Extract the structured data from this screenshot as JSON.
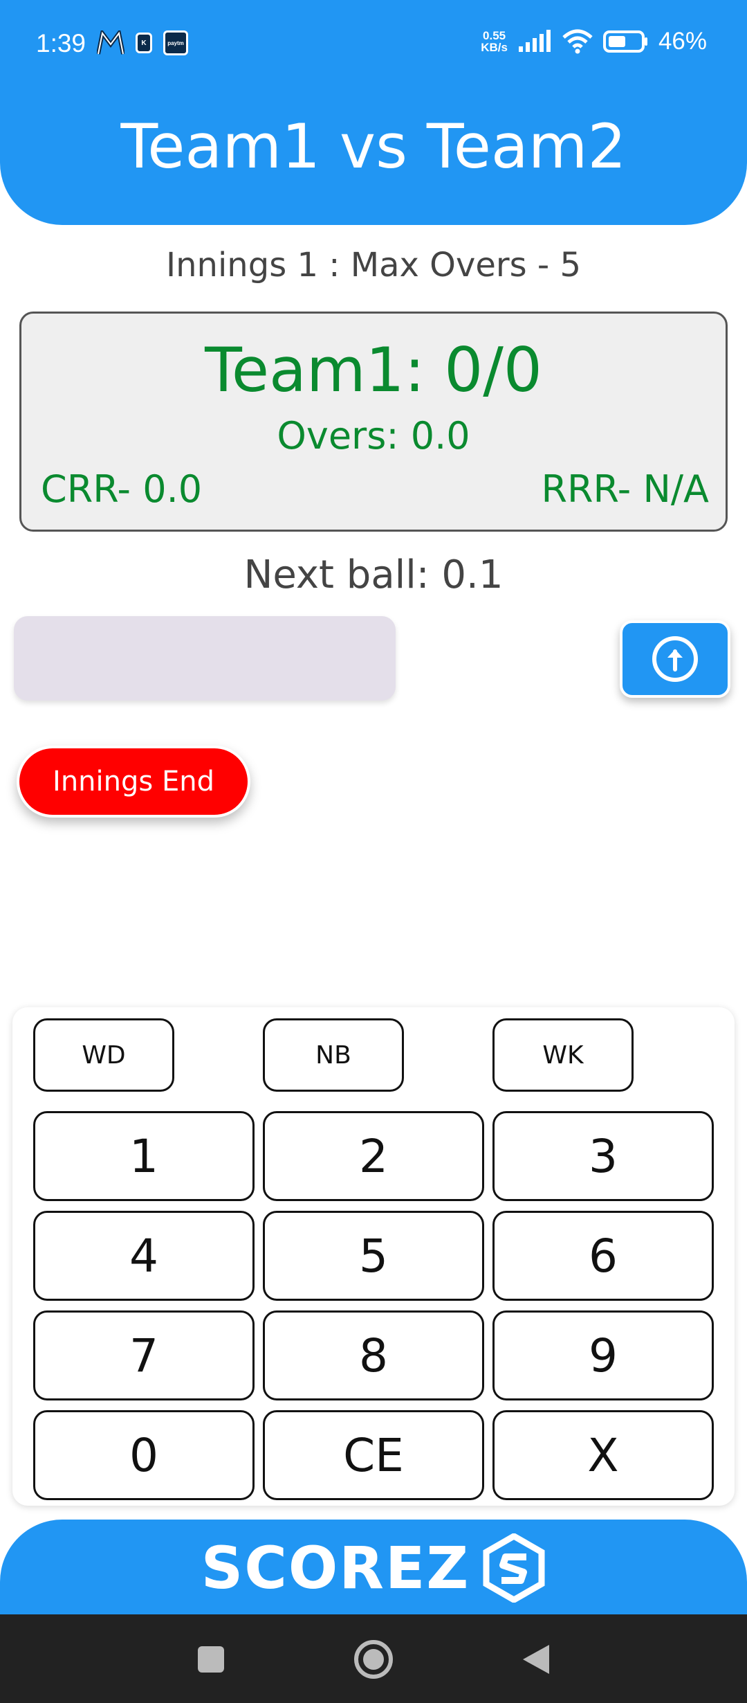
{
  "status_bar": {
    "time": "1:39",
    "net_speed_value": "0.55",
    "net_speed_unit": "KB/s",
    "battery": "46%",
    "app_icon_paytm": "paytm",
    "app_icon_k": "K"
  },
  "header": {
    "title": "Team1 vs Team2"
  },
  "innings": {
    "info": "Innings 1 : Max Overs - 5"
  },
  "scorecard": {
    "score": "Team1: 0/0",
    "overs": "Overs: 0.0",
    "crr": "CRR- 0.0",
    "rrr": "RRR- N/A"
  },
  "next_ball": "Next ball: 0.1",
  "entry": {
    "value": ""
  },
  "buttons": {
    "innings_end": "Innings End"
  },
  "keypad": {
    "extras": [
      "WD",
      "NB",
      "WK"
    ],
    "rows": [
      [
        "1",
        "2",
        "3"
      ],
      [
        "4",
        "5",
        "6"
      ],
      [
        "7",
        "8",
        "9"
      ],
      [
        "0",
        "CE",
        "X"
      ]
    ]
  },
  "footer": {
    "brand": "SCOREZ"
  },
  "colors": {
    "primary": "#2196F3",
    "score_green": "#0a8a2f",
    "danger": "#ff0000",
    "entry_bg": "#e4dfea",
    "nav_bg": "#222222"
  },
  "icons": {
    "submit": "arrow-up-circle-icon",
    "brand_logo": "scorez-logo-icon",
    "nav_recent": "square-icon",
    "nav_home": "circle-icon",
    "nav_back": "triangle-back-icon"
  }
}
